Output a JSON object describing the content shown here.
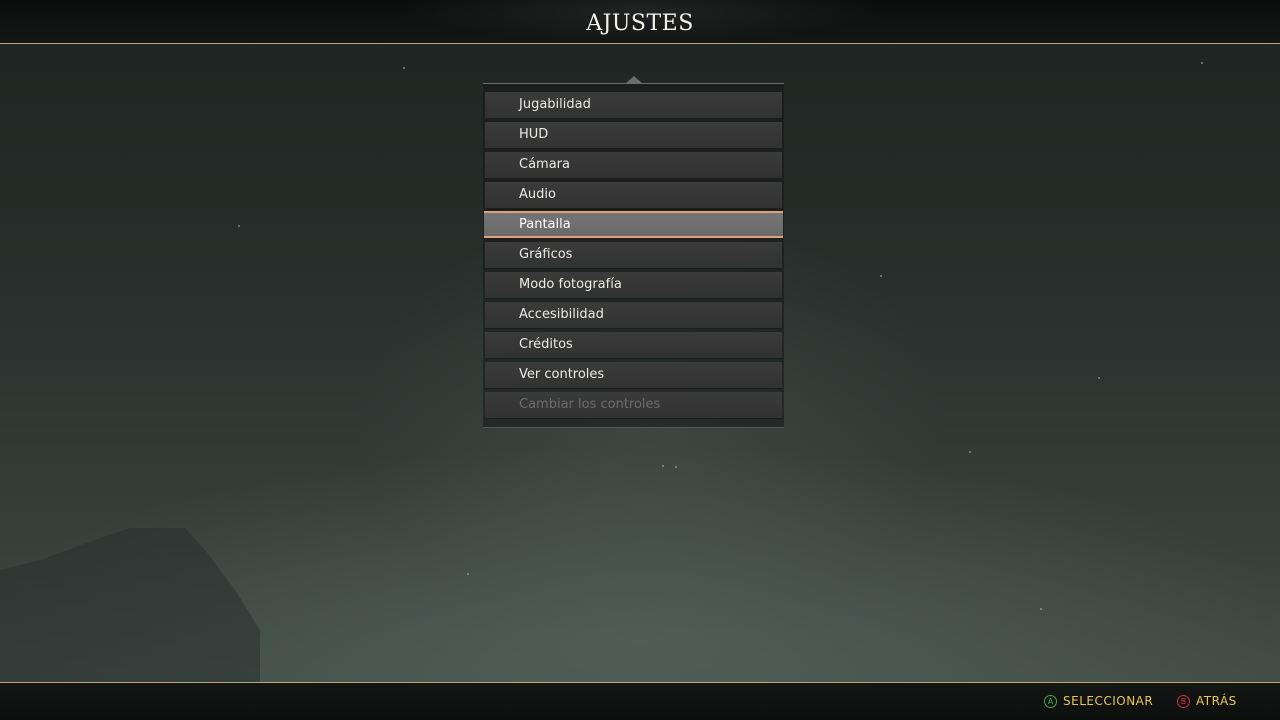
{
  "header": {
    "title": "AJUSTES"
  },
  "menu": {
    "selected_index": 4,
    "items": [
      {
        "label": "Jugabilidad",
        "state": "normal"
      },
      {
        "label": "HUD",
        "state": "normal"
      },
      {
        "label": "Cámara",
        "state": "normal"
      },
      {
        "label": "Audio",
        "state": "normal"
      },
      {
        "label": "Pantalla",
        "state": "selected"
      },
      {
        "label": "Gráficos",
        "state": "normal"
      },
      {
        "label": "Modo fotografía",
        "state": "normal"
      },
      {
        "label": "Accesibilidad",
        "state": "normal"
      },
      {
        "label": "Créditos",
        "state": "normal"
      },
      {
        "label": "Ver controles",
        "state": "normal"
      },
      {
        "label": "Cambiar los controles",
        "state": "disabled"
      }
    ]
  },
  "footer": {
    "prompts": [
      {
        "button": "A",
        "label": "SELECCIONAR",
        "color": "#3fae4a",
        "icon": "a-button-icon"
      },
      {
        "button": "B",
        "label": "ATRÁS",
        "color": "#d0313a",
        "icon": "b-button-icon"
      }
    ]
  },
  "colors": {
    "accent_rule": "#b7a77a",
    "selection_border": "#e0a07c",
    "prompt_text": "#e6c65a"
  }
}
